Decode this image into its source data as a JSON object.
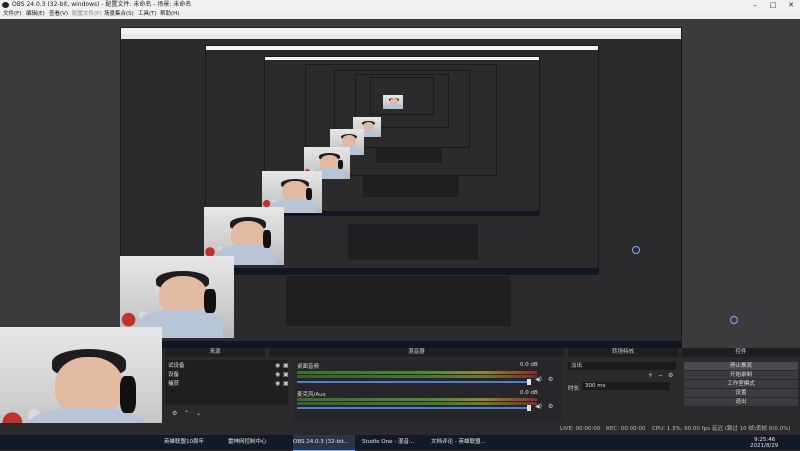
{
  "window": {
    "title": "OBS 24.0.3 (32-bit, windows) - 配置文件: 未命名 - 场景: 未命名"
  },
  "menu": [
    "文件(F)",
    "编辑(E)",
    "查看(V)",
    "配置文件(P)",
    "场景集合(S)",
    "工具(T)",
    "帮助(H)"
  ],
  "docks": {
    "sources": "来源",
    "mixer": "混音器",
    "transitions": "转场特效",
    "controls": "控件"
  },
  "sources": {
    "items": [
      "音频输入采集",
      "麦克风",
      "窗口捕获"
    ]
  },
  "mixer": {
    "tracks": [
      {
        "name": "桌面音频",
        "level": "0.0 dB"
      },
      {
        "name": "麦克风/Aux",
        "level": "0.0 dB"
      }
    ],
    "partial_left_labels": [
      "试设备",
      "设备",
      "捕获"
    ]
  },
  "transitions": {
    "selected": "淡出",
    "duration_label": "时长",
    "duration_value": "300 ms"
  },
  "controls": {
    "buttons": [
      "停止推流",
      "开始录制",
      "工作室模式",
      "设置",
      "退出"
    ]
  },
  "status": {
    "live": "LIVE: 00:00:00",
    "rec": "REC: 00:00:00",
    "cpu": "CPU: 1.3%, 60.00 fps",
    "network": "延迟 (跳过 10 帧)丢帧 0(0.0%)"
  },
  "taskbar": {
    "items": [
      "英雄联盟10周年",
      "雷神网控制中心",
      "OBS 24.0.3 (32-bit...",
      "Studio One - 混音...",
      "文档评论 - 英雄联盟..."
    ],
    "time": "9:25:46",
    "date": "2021/8/29"
  },
  "icons": [
    "windows-icon",
    "eye-icon",
    "lock-icon",
    "gear-icon",
    "speaker-icon",
    "plus-icon",
    "minus-icon",
    "chevron-up-icon",
    "chevron-down-icon"
  ],
  "colors": {
    "accent": "#4a7fd1",
    "meter_green": "#4d8a37",
    "meter_red": "#8b2b2b",
    "taskbar": "#121a27"
  }
}
